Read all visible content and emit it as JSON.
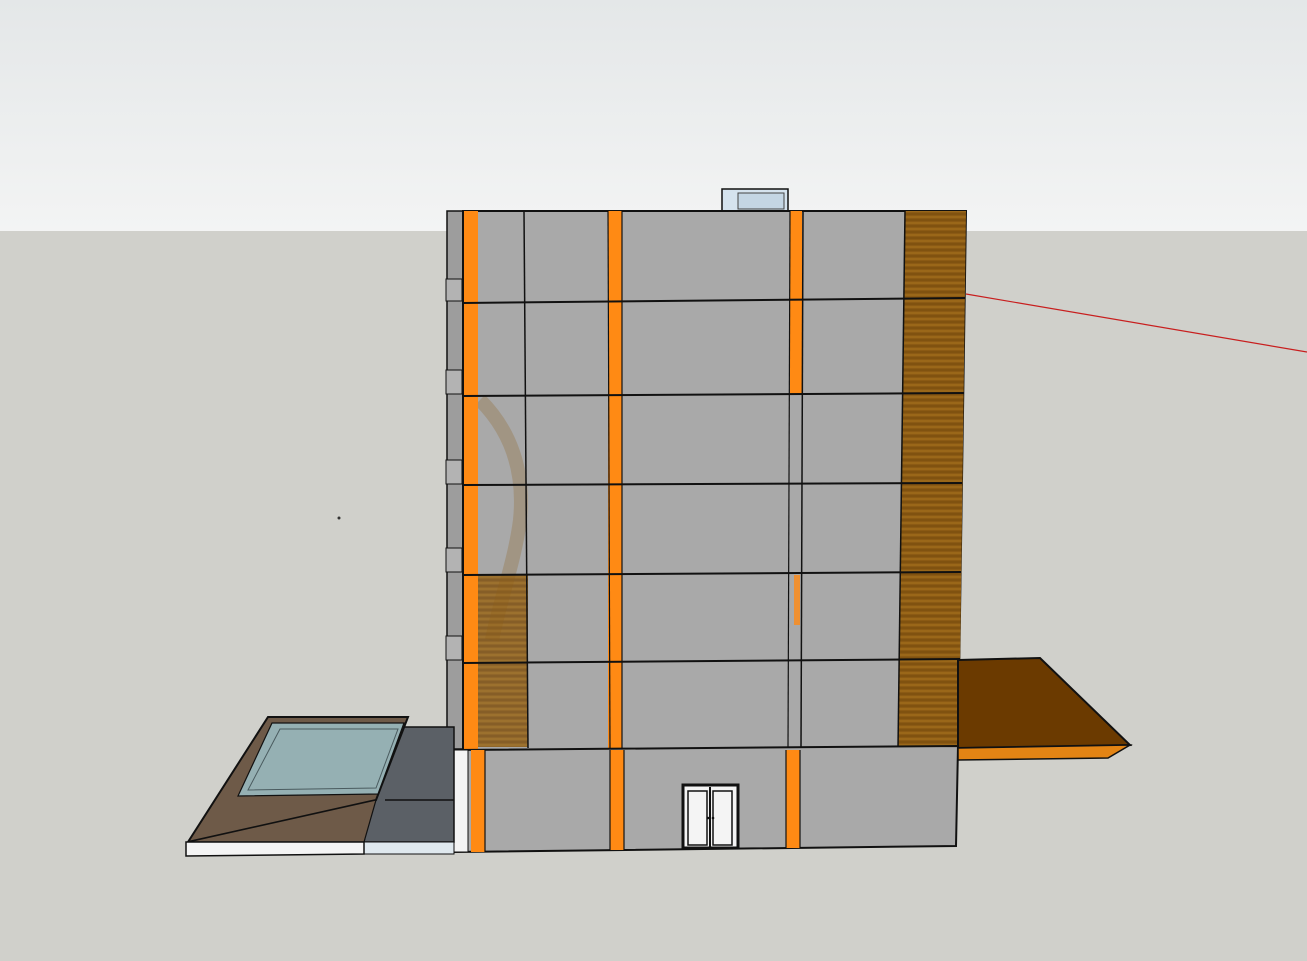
{
  "viewport": {
    "colors": {
      "sky_top": "#e4e7e8",
      "sky_bottom": "#f3f4f4",
      "ground": "#d0d0cb",
      "facade": "#a9a9a9",
      "facade_side": "#9d9d9d",
      "orange_accent": "#ff8a14",
      "wood_panel": "#8b5a14",
      "canopy": "#6b3a00",
      "canopy_edge": "#e38414",
      "water": "#95b0b3",
      "planter": "#6e5a48",
      "annex": "#5b6066",
      "roof_box": "#d5e3ee",
      "axis_line": "#c81e1e",
      "edge": "#111111"
    }
  }
}
